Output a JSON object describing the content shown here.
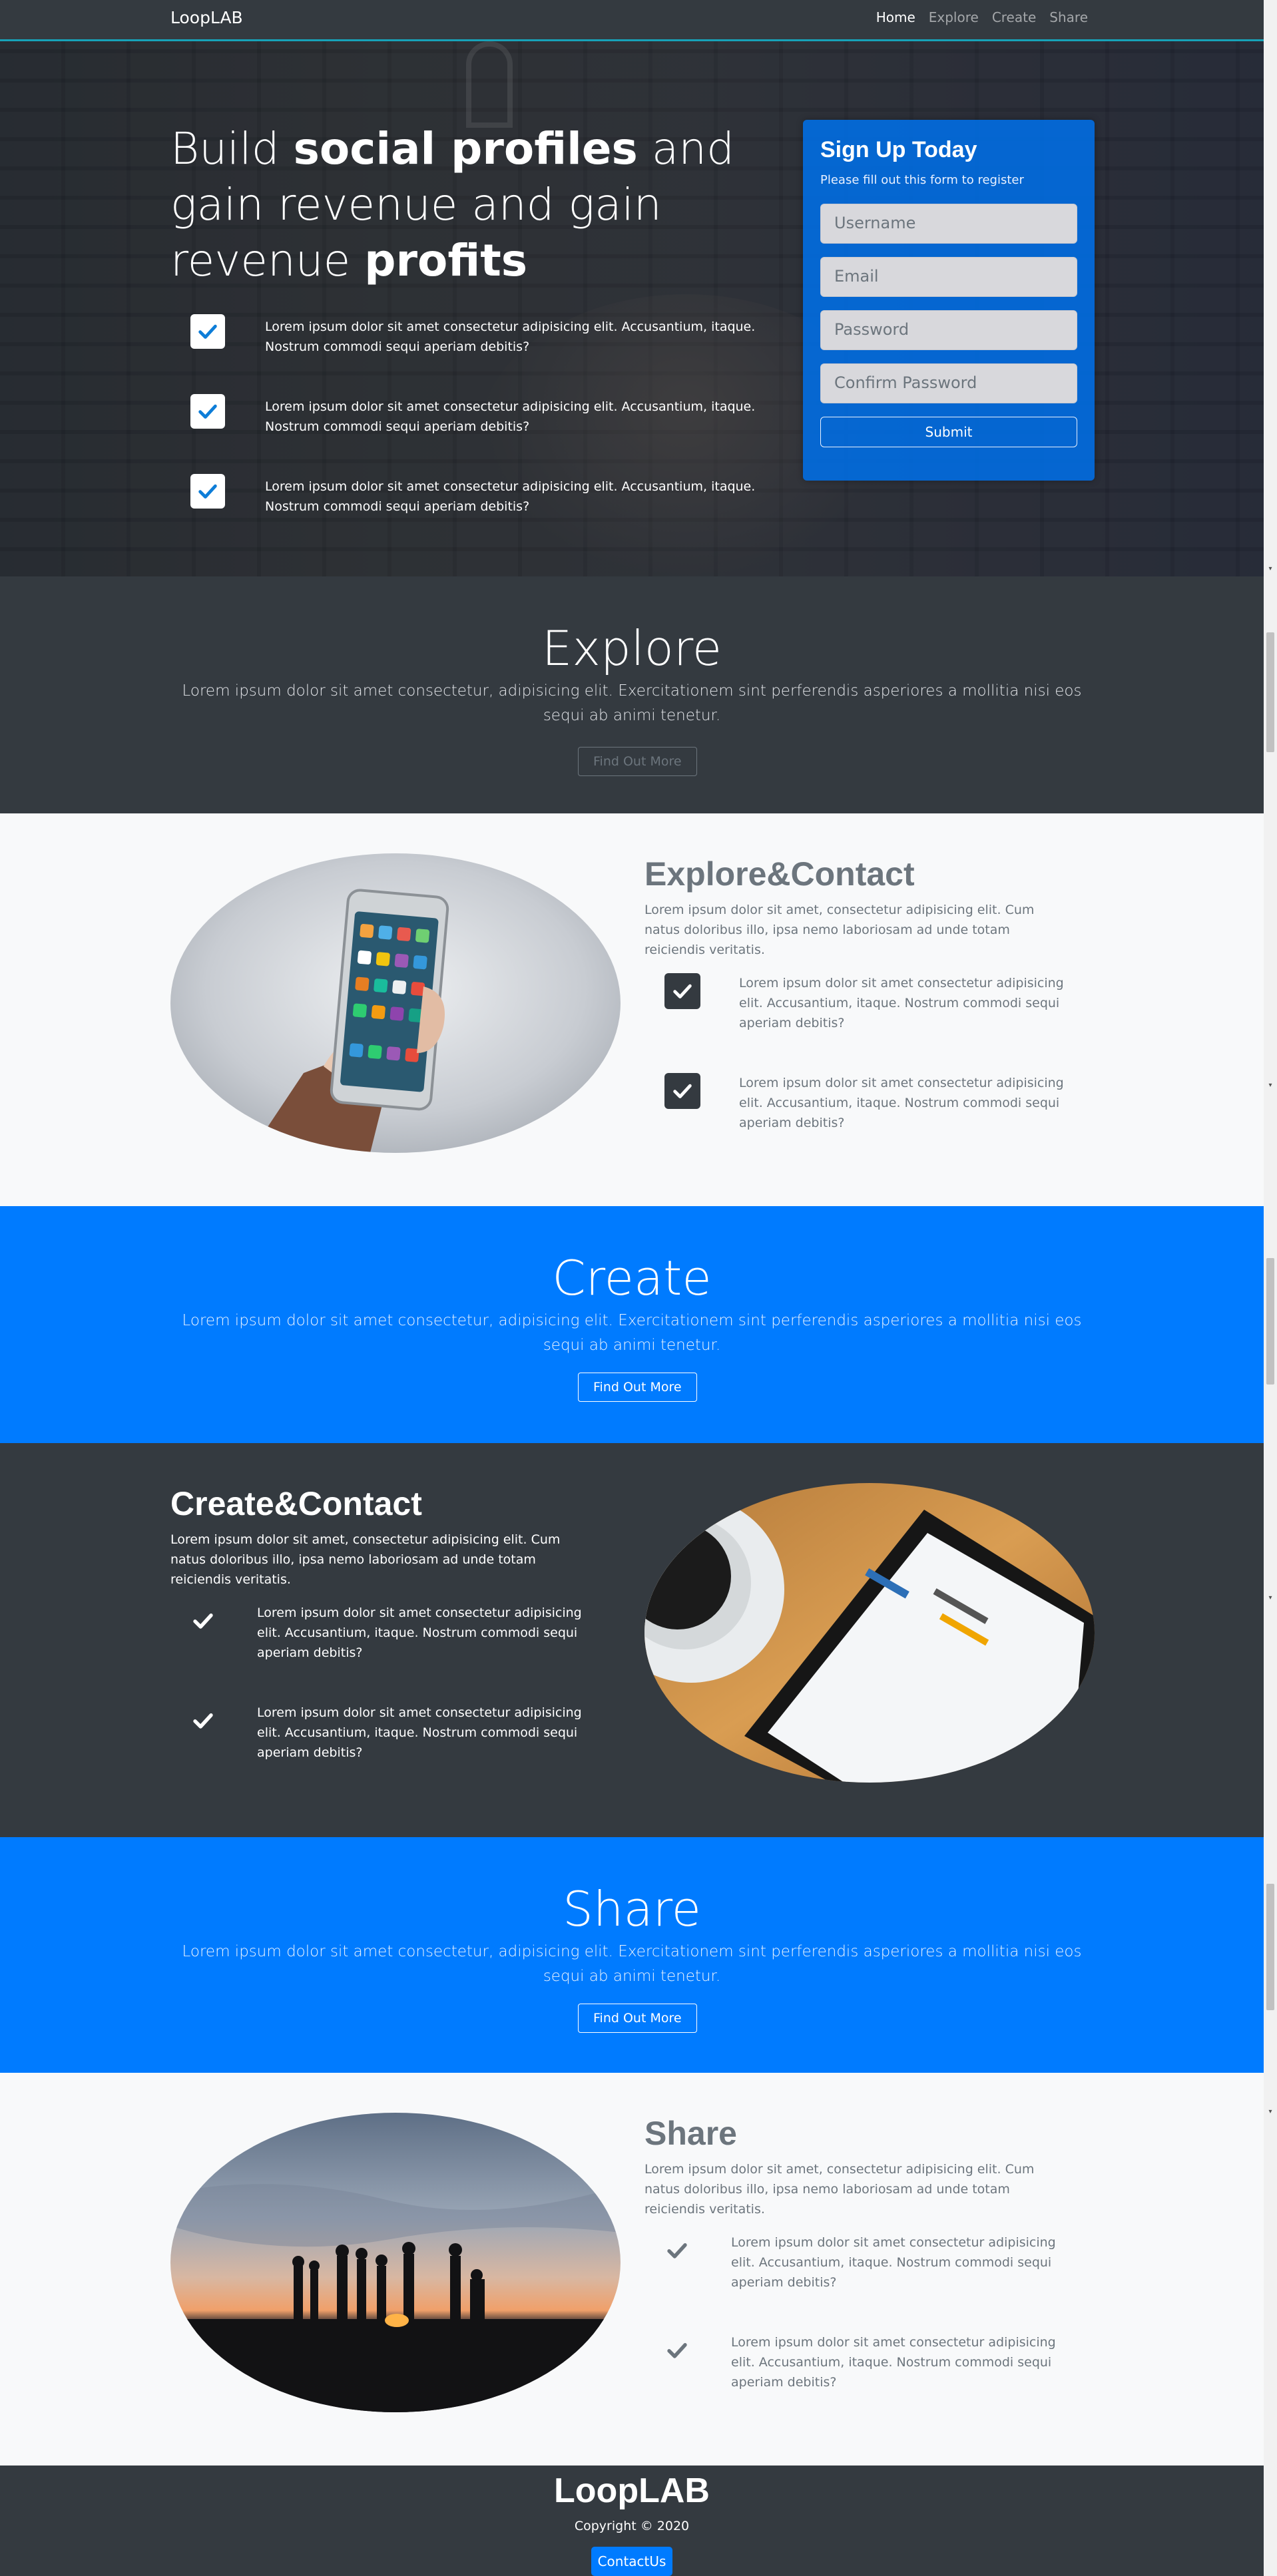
{
  "navbar": {
    "brand": "LoopLAB",
    "links": [
      "Home",
      "Explore",
      "Create",
      "Share"
    ]
  },
  "hero": {
    "title_parts": [
      "Build ",
      "social profiles",
      " and gain revenue and gain revenue ",
      "profits"
    ],
    "checks": [
      "Lorem ipsum dolor sit amet consectetur adipisicing elit. Accusantium, itaque. Nostrum commodi sequi aperiam debitis?",
      "Lorem ipsum dolor sit amet consectetur adipisicing elit. Accusantium, itaque. Nostrum commodi sequi aperiam debitis?",
      "Lorem ipsum dolor sit amet consectetur adipisicing elit. Accusantium, itaque. Nostrum commodi sequi aperiam debitis?"
    ]
  },
  "signup": {
    "title": "Sign Up Today",
    "subtitle": "Please fill out this form to register",
    "username_placeholder": "Username",
    "email_placeholder": "Email",
    "password_placeholder": "Password",
    "confirm_placeholder": "Confirm Password",
    "submit_label": "Submit"
  },
  "explore": {
    "title": "Explore",
    "text": "Lorem ipsum dolor sit amet consectetur, adipisicing elit. Exercitationem sint perferendis asperiores a mollitia nisi eos sequi ab animi tenetur.",
    "button": "Find Out More"
  },
  "explore_contact": {
    "title": "Explore&Contact",
    "lead": "Lorem ipsum dolor sit amet, consectetur adipisicing elit. Cum natus doloribus illo, ipsa nemo laboriosam ad unde totam reiciendis veritatis.",
    "items": [
      "Lorem ipsum dolor sit amet consectetur adipisicing elit. Accusantium, itaque. Nostrum commodi sequi aperiam debitis?",
      "Lorem ipsum dolor sit amet consectetur adipisicing elit. Accusantium, itaque. Nostrum commodi sequi aperiam debitis?"
    ]
  },
  "create": {
    "title": "Create",
    "text": "Lorem ipsum dolor sit amet consectetur, adipisicing elit. Exercitationem sint perferendis asperiores a mollitia nisi eos sequi ab animi tenetur.",
    "button": "Find Out More"
  },
  "create_contact": {
    "title": "Create&Contact",
    "lead": "Lorem ipsum dolor sit amet, consectetur adipisicing elit. Cum natus doloribus illo, ipsa nemo laboriosam ad unde totam reiciendis veritatis.",
    "items": [
      "Lorem ipsum dolor sit amet consectetur adipisicing elit. Accusantium, itaque. Nostrum commodi sequi aperiam debitis?",
      "Lorem ipsum dolor sit amet consectetur adipisicing elit. Accusantium, itaque. Nostrum commodi sequi aperiam debitis?"
    ]
  },
  "share": {
    "title": "Share",
    "text": "Lorem ipsum dolor sit amet consectetur, adipisicing elit. Exercitationem sint perferendis asperiores a mollitia nisi eos sequi ab animi tenetur.",
    "button": "Find Out More"
  },
  "share_section": {
    "title": "Share",
    "lead": "Lorem ipsum dolor sit amet, consectetur adipisicing elit. Cum natus doloribus illo, ipsa nemo laboriosam ad unde totam reiciendis veritatis.",
    "items": [
      "Lorem ipsum dolor sit amet consectetur adipisicing elit. Accusantium, itaque. Nostrum commodi sequi aperiam debitis?",
      "Lorem ipsum dolor sit amet consectetur adipisicing elit. Accusantium, itaque. Nostrum commodi sequi aperiam debitis?"
    ]
  },
  "footer": {
    "brand": "LoopLAB",
    "copyright": "Copyright © 2020",
    "contact_button": "ContactUs"
  },
  "colors": {
    "dark": "#343a40",
    "primary": "#007bff",
    "light": "#f8f9fa",
    "accent_line": "#17a2b8",
    "check_blue": "#0d7dd8"
  },
  "icons": [
    "check-square-icon",
    "check-icon"
  ]
}
